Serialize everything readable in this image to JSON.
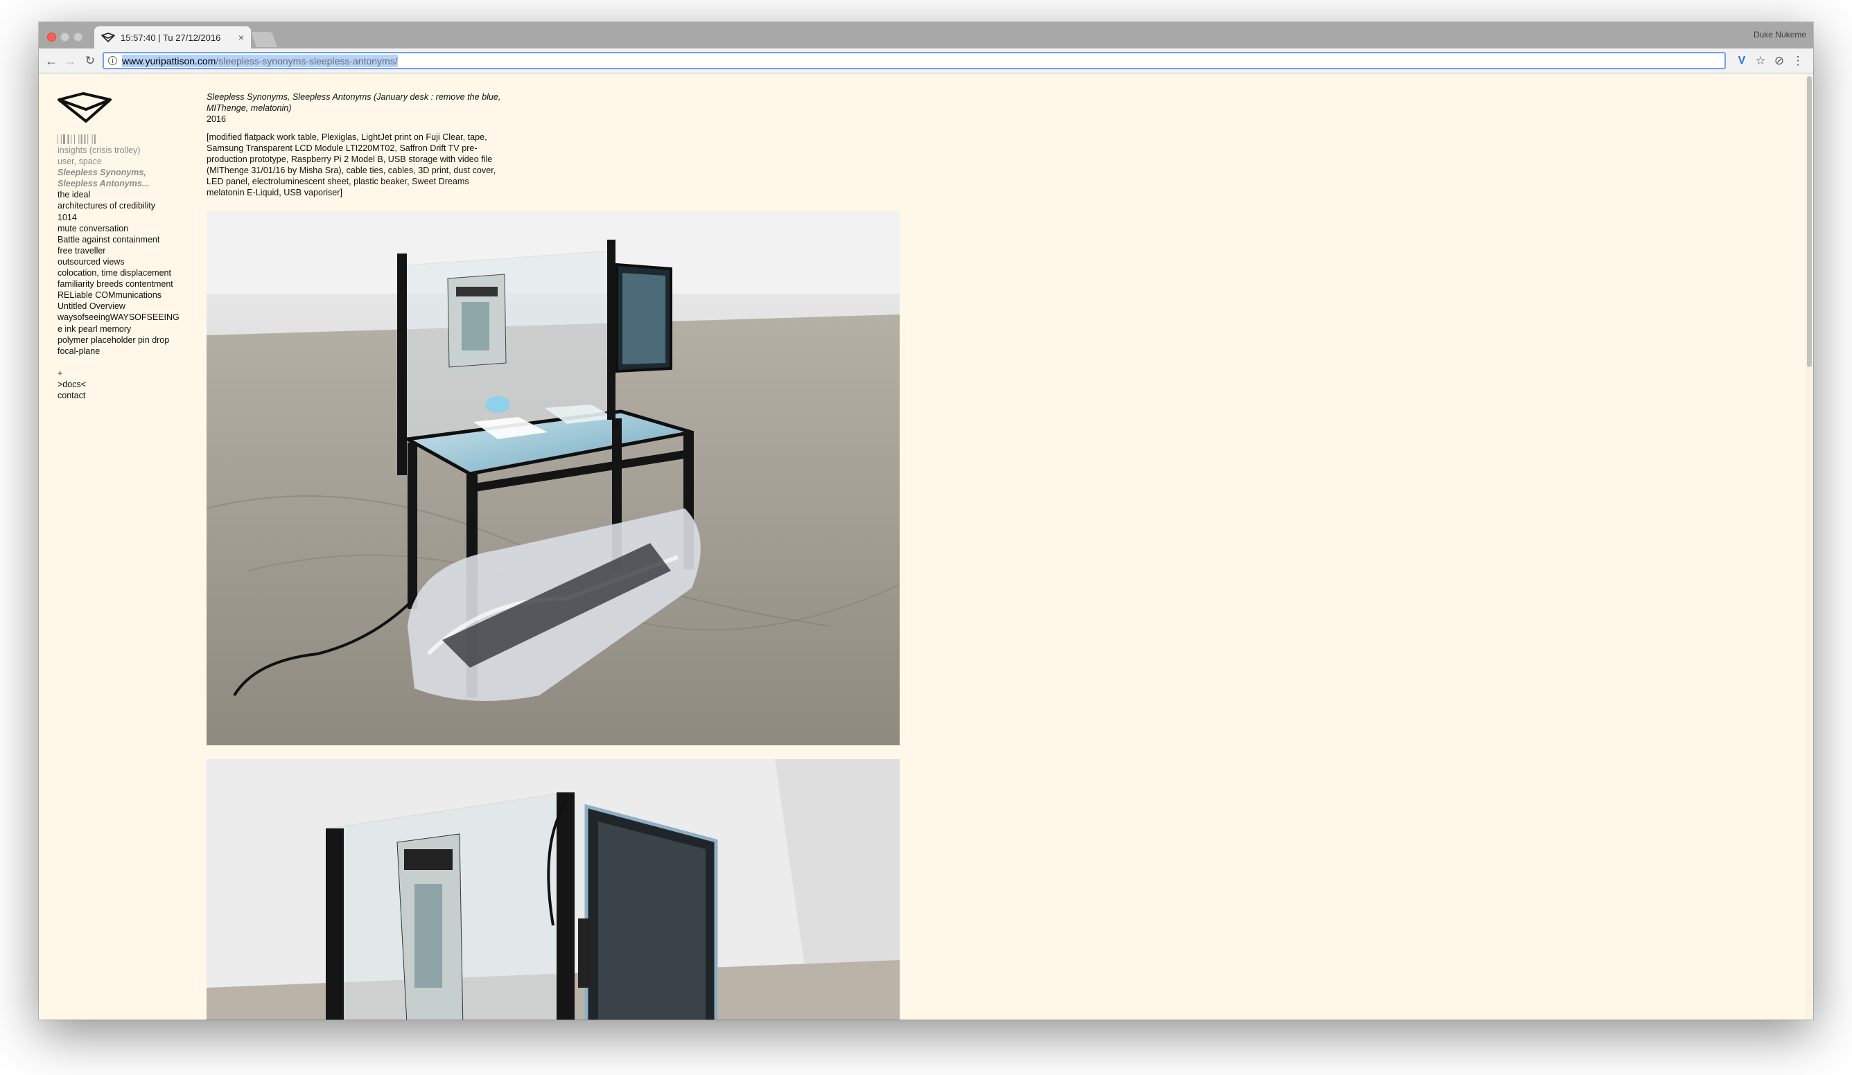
{
  "browser": {
    "tab_title": "15:57:40 | Tu 27/12/2016",
    "tab_close": "×",
    "profile_name": "Duke Nukeme",
    "url_host": "www.yuripattison.com",
    "url_path": "/sleepless-synonyms-sleepless-antonyms/",
    "back_glyph": "←",
    "forward_glyph": "→",
    "reload_glyph": "↻",
    "info_glyph": "i",
    "ext_v_glyph": "V",
    "star_glyph": "☆",
    "ghost_glyph": "⊘",
    "menu_glyph": "⋮"
  },
  "sidebar": {
    "items": [
      {
        "label": "insights (crisis trolley)",
        "style": "gray"
      },
      {
        "label": "user, space",
        "style": "gray"
      },
      {
        "label": "Sleepless Synonyms,",
        "style": "active"
      },
      {
        "label": "Sleepless Antonyms...",
        "style": "active"
      },
      {
        "label": "the ideal",
        "style": "normal"
      },
      {
        "label": "architectures of credibility",
        "style": "normal"
      },
      {
        "label": "1014",
        "style": "normal"
      },
      {
        "label": "mute conversation",
        "style": "normal"
      },
      {
        "label": "Battle against containment",
        "style": "normal"
      },
      {
        "label": "free traveller",
        "style": "normal"
      },
      {
        "label": "outsourced views",
        "style": "normal"
      },
      {
        "label": "colocation, time displacement",
        "style": "normal"
      },
      {
        "label": "familiarity breeds contentment",
        "style": "normal"
      },
      {
        "label": "RELiable COMmunications",
        "style": "normal"
      },
      {
        "label": "Untitled Overview",
        "style": "normal"
      },
      {
        "label": "waysofseeingWAYSOFSEEING",
        "style": "normal"
      },
      {
        "label": "e ink pearl memory",
        "style": "normal"
      },
      {
        "label": "polymer placeholder pin drop",
        "style": "normal"
      },
      {
        "label": "focal-plane",
        "style": "normal"
      }
    ],
    "footer": [
      {
        "label": "+"
      },
      {
        "label": ">docs<"
      },
      {
        "label": "contact"
      }
    ]
  },
  "work": {
    "title_line1": "Sleepless Synonyms, Sleepless Antonyms (January desk : remove the blue,",
    "title_line2": "MIThenge, melatonin)",
    "year": "2016",
    "details_lines": [
      "[modified flatpack work table, Plexiglas, LightJet print on Fuji Clear, tape,",
      "Samsung Transparent LCD Module LTI220MT02, Saffron Drift TV pre-",
      "production prototype, Raspberry Pi 2 Model B, USB storage with video file",
      "(MIThenge 31/01/16 by Misha Sra), cable ties, cables, 3D print, dust cover,",
      "LED panel, electroluminescent sheet, plastic beaker, Sweet Dreams",
      "melatonin E-Liquid, USB vaporiser]"
    ]
  },
  "colors": {
    "page_bg": "#fff8e8",
    "nav_gray": "#8c8c8c",
    "omnibox_focus": "#6f9ff3",
    "url_selection": "#b4d3fc"
  }
}
